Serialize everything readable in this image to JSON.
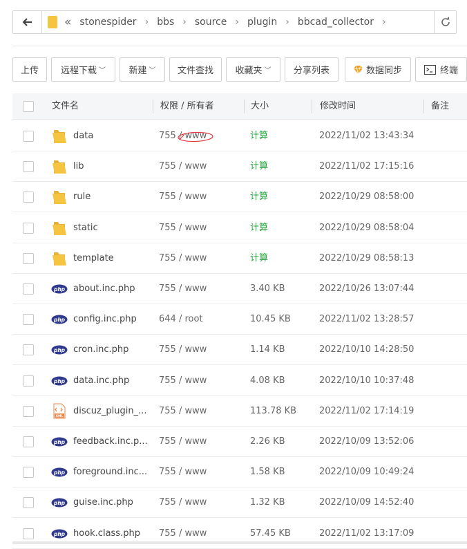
{
  "address": {
    "path": [
      "stonespider",
      "bbs",
      "source",
      "plugin",
      "bbcad_collector"
    ]
  },
  "toolbar": {
    "upload": "上传",
    "remote_download": "远程下载",
    "new": "新建",
    "find_file": "文件查找",
    "favorites": "收藏夹",
    "share_list": "分享列表",
    "data_sync": "数据同步",
    "terminal": "终端"
  },
  "table": {
    "headers": {
      "name": "文件名",
      "perm": "权限 / 所有者",
      "size": "大小",
      "mtime": "修改时间",
      "note": "备注"
    },
    "rows": [
      {
        "type": "folder",
        "name": "data",
        "perm": "755 / www",
        "size": "计算",
        "mtime": "2022/11/02 13:43:34"
      },
      {
        "type": "folder",
        "name": "lib",
        "perm": "755 / www",
        "size": "计算",
        "mtime": "2022/11/02 17:15:16"
      },
      {
        "type": "folder",
        "name": "rule",
        "perm": "755 / www",
        "size": "计算",
        "mtime": "2022/10/29 08:58:00"
      },
      {
        "type": "folder",
        "name": "static",
        "perm": "755 / www",
        "size": "计算",
        "mtime": "2022/10/29 08:58:04"
      },
      {
        "type": "folder",
        "name": "template",
        "perm": "755 / www",
        "size": "计算",
        "mtime": "2022/10/29 08:58:13"
      },
      {
        "type": "php",
        "name": "about.inc.php",
        "perm": "755 / www",
        "size": "3.40 KB",
        "mtime": "2022/10/26 13:07:44"
      },
      {
        "type": "php",
        "name": "config.inc.php",
        "perm": "644 / root",
        "size": "10.45 KB",
        "mtime": "2022/11/02 13:28:57"
      },
      {
        "type": "php",
        "name": "cron.inc.php",
        "perm": "755 / www",
        "size": "1.14 KB",
        "mtime": "2022/10/10 14:28:50"
      },
      {
        "type": "php",
        "name": "data.inc.php",
        "perm": "755 / www",
        "size": "4.08 KB",
        "mtime": "2022/10/10 10:37:48"
      },
      {
        "type": "xml",
        "name": "discuz_plugin_...",
        "perm": "755 / www",
        "size": "113.78 KB",
        "mtime": "2022/11/02 17:14:19"
      },
      {
        "type": "php",
        "name": "feedback.inc.p...",
        "perm": "755 / www",
        "size": "2.26 KB",
        "mtime": "2022/10/09 13:52:06"
      },
      {
        "type": "php",
        "name": "foreground.inc...",
        "perm": "755 / www",
        "size": "1.58 KB",
        "mtime": "2022/10/09 10:49:24"
      },
      {
        "type": "php",
        "name": "guise.inc.php",
        "perm": "755 / www",
        "size": "1.32 KB",
        "mtime": "2022/10/09 14:52:40"
      },
      {
        "type": "php",
        "name": "hook.class.php",
        "perm": "755 / www",
        "size": "57.45 KB",
        "mtime": "2022/11/02 13:17:09"
      }
    ]
  },
  "icons": {
    "php_label": "php",
    "xml_label": "XML"
  },
  "colors": {
    "calc_green": "#20a53a",
    "folder_yellow": "#f5c542",
    "php_navy": "#2f3a8f",
    "annotation_red": "#e0393e"
  }
}
